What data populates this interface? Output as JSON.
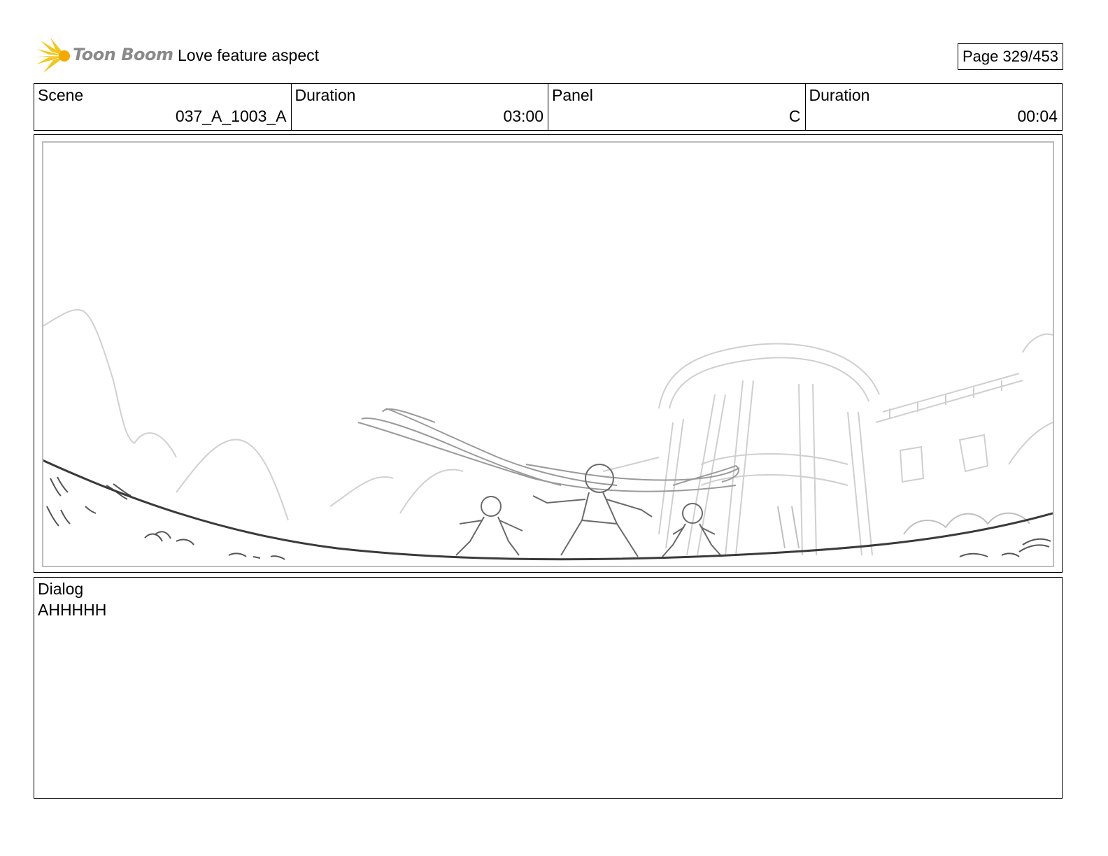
{
  "header": {
    "logo_text": "Toon Boom",
    "project_title": "Love feature aspect",
    "page_counter": "Page 329/453"
  },
  "info": {
    "scene_label": "Scene",
    "scene_value": "037_A_1003_A",
    "scene_duration_label": "Duration",
    "scene_duration_value": "03:00",
    "panel_label": "Panel",
    "panel_value": "C",
    "panel_duration_label": "Duration",
    "panel_duration_value": "00:04"
  },
  "dialog": {
    "label": "Dialog",
    "text": "AHHHHH"
  },
  "colors": {
    "logo_accent": "#f5c518",
    "logo_text": "#8a8a8a",
    "sketch_dark": "#444444",
    "sketch_light": "#c8c8c8"
  }
}
